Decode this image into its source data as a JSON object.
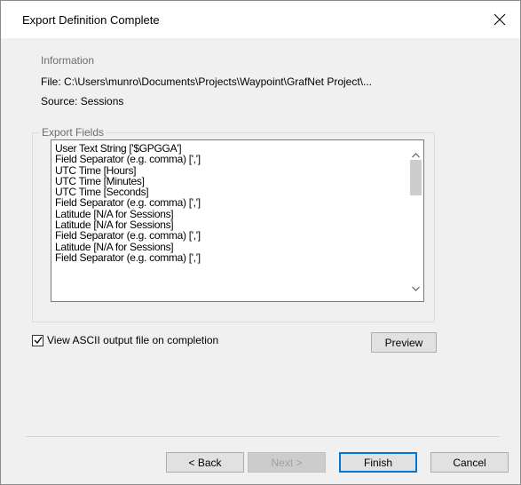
{
  "window": {
    "title": "Export Definition Complete"
  },
  "information": {
    "label": "Information",
    "file_line": "File: C:\\Users\\munro\\Documents\\Projects\\Waypoint\\GrafNet Project\\...",
    "source_line": "Source: Sessions"
  },
  "export_fields": {
    "label": "Export Fields",
    "items": [
      "User Text String ['$GPGGA']",
      "Field Separator (e.g. comma) [',']",
      "UTC Time [Hours]",
      "UTC Time [Minutes]",
      "UTC Time [Seconds]",
      "Field Separator (e.g. comma) [',']",
      "Latitude [N/A for Sessions]",
      "Latitude [N/A for Sessions]",
      "Field Separator (e.g. comma) [',']",
      "Latitude [N/A for Sessions]",
      "Field Separator (e.g. comma) [',']"
    ]
  },
  "options": {
    "view_ascii_label": "View ASCII output file on completion",
    "view_ascii_checked": true
  },
  "buttons": {
    "preview": "Preview",
    "back": "< Back",
    "next": "Next >",
    "finish": "Finish",
    "cancel": "Cancel"
  },
  "icons": {
    "close": "close-icon",
    "scroll_up": "chevron-up-icon",
    "scroll_down": "chevron-down-icon",
    "check": "checkmark-icon"
  },
  "colors": {
    "dialog_bg": "#f0f0f0",
    "default_button_border": "#0078d7"
  }
}
